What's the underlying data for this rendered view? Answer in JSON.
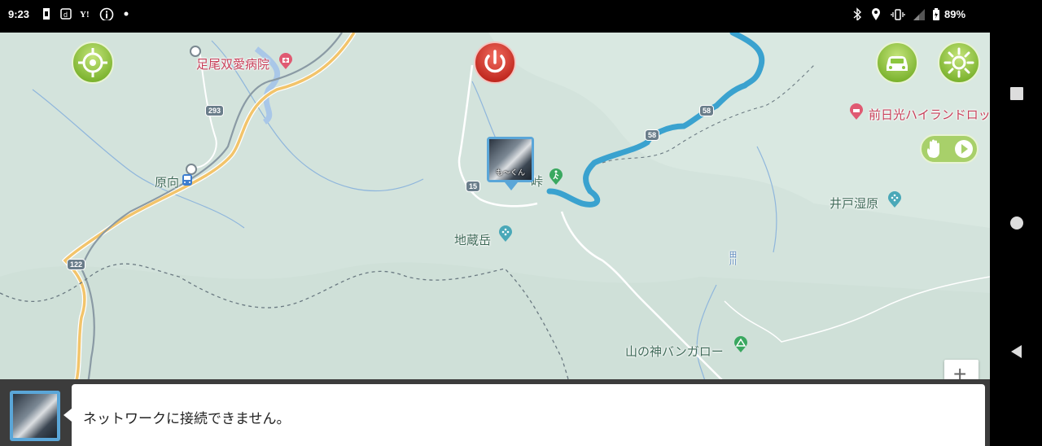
{
  "status_bar": {
    "time": "9:23",
    "notification_icons": [
      "sim-icon",
      "docomo-d-icon",
      "yahoo-icon",
      "info-icon",
      "dot-icon"
    ],
    "system_icons": [
      "bluetooth-icon",
      "location-icon",
      "vibrate-icon",
      "signal-icon",
      "battery-icon"
    ],
    "battery": "89%"
  },
  "map": {
    "places": {
      "hospital": "足尾双愛病院",
      "station": "原向",
      "highland": "前日光ハイランドロッ",
      "marsh": "井戸湿原",
      "mountain": "地蔵岳",
      "bungalow": "山の神バンガロー",
      "trail_partial": "峠",
      "river": "田川"
    },
    "road_numbers": {
      "r293": "293",
      "r122": "122",
      "r15": "15",
      "r58a": "58",
      "r58b": "58"
    },
    "zoom_in": "+",
    "colors": {
      "route": "#3aa2cf",
      "land": "#d5e4dd",
      "road_yellow": "#f2c46b",
      "button_green": "#8cc63f",
      "power_red": "#d93a2f"
    }
  },
  "controls": {
    "target_icon": "crosshair-icon",
    "power_icon": "power-icon",
    "car_icon": "car-icon",
    "brightness_icon": "sun-icon",
    "hand_icon": "hand-icon",
    "play_icon": "play-icon"
  },
  "user_marker": {
    "name": "も～くん"
  },
  "message": {
    "text": "ネットワークに接続できません。"
  },
  "nav_bar": {
    "recents": "recents-icon",
    "home": "home-icon",
    "back": "back-icon"
  }
}
